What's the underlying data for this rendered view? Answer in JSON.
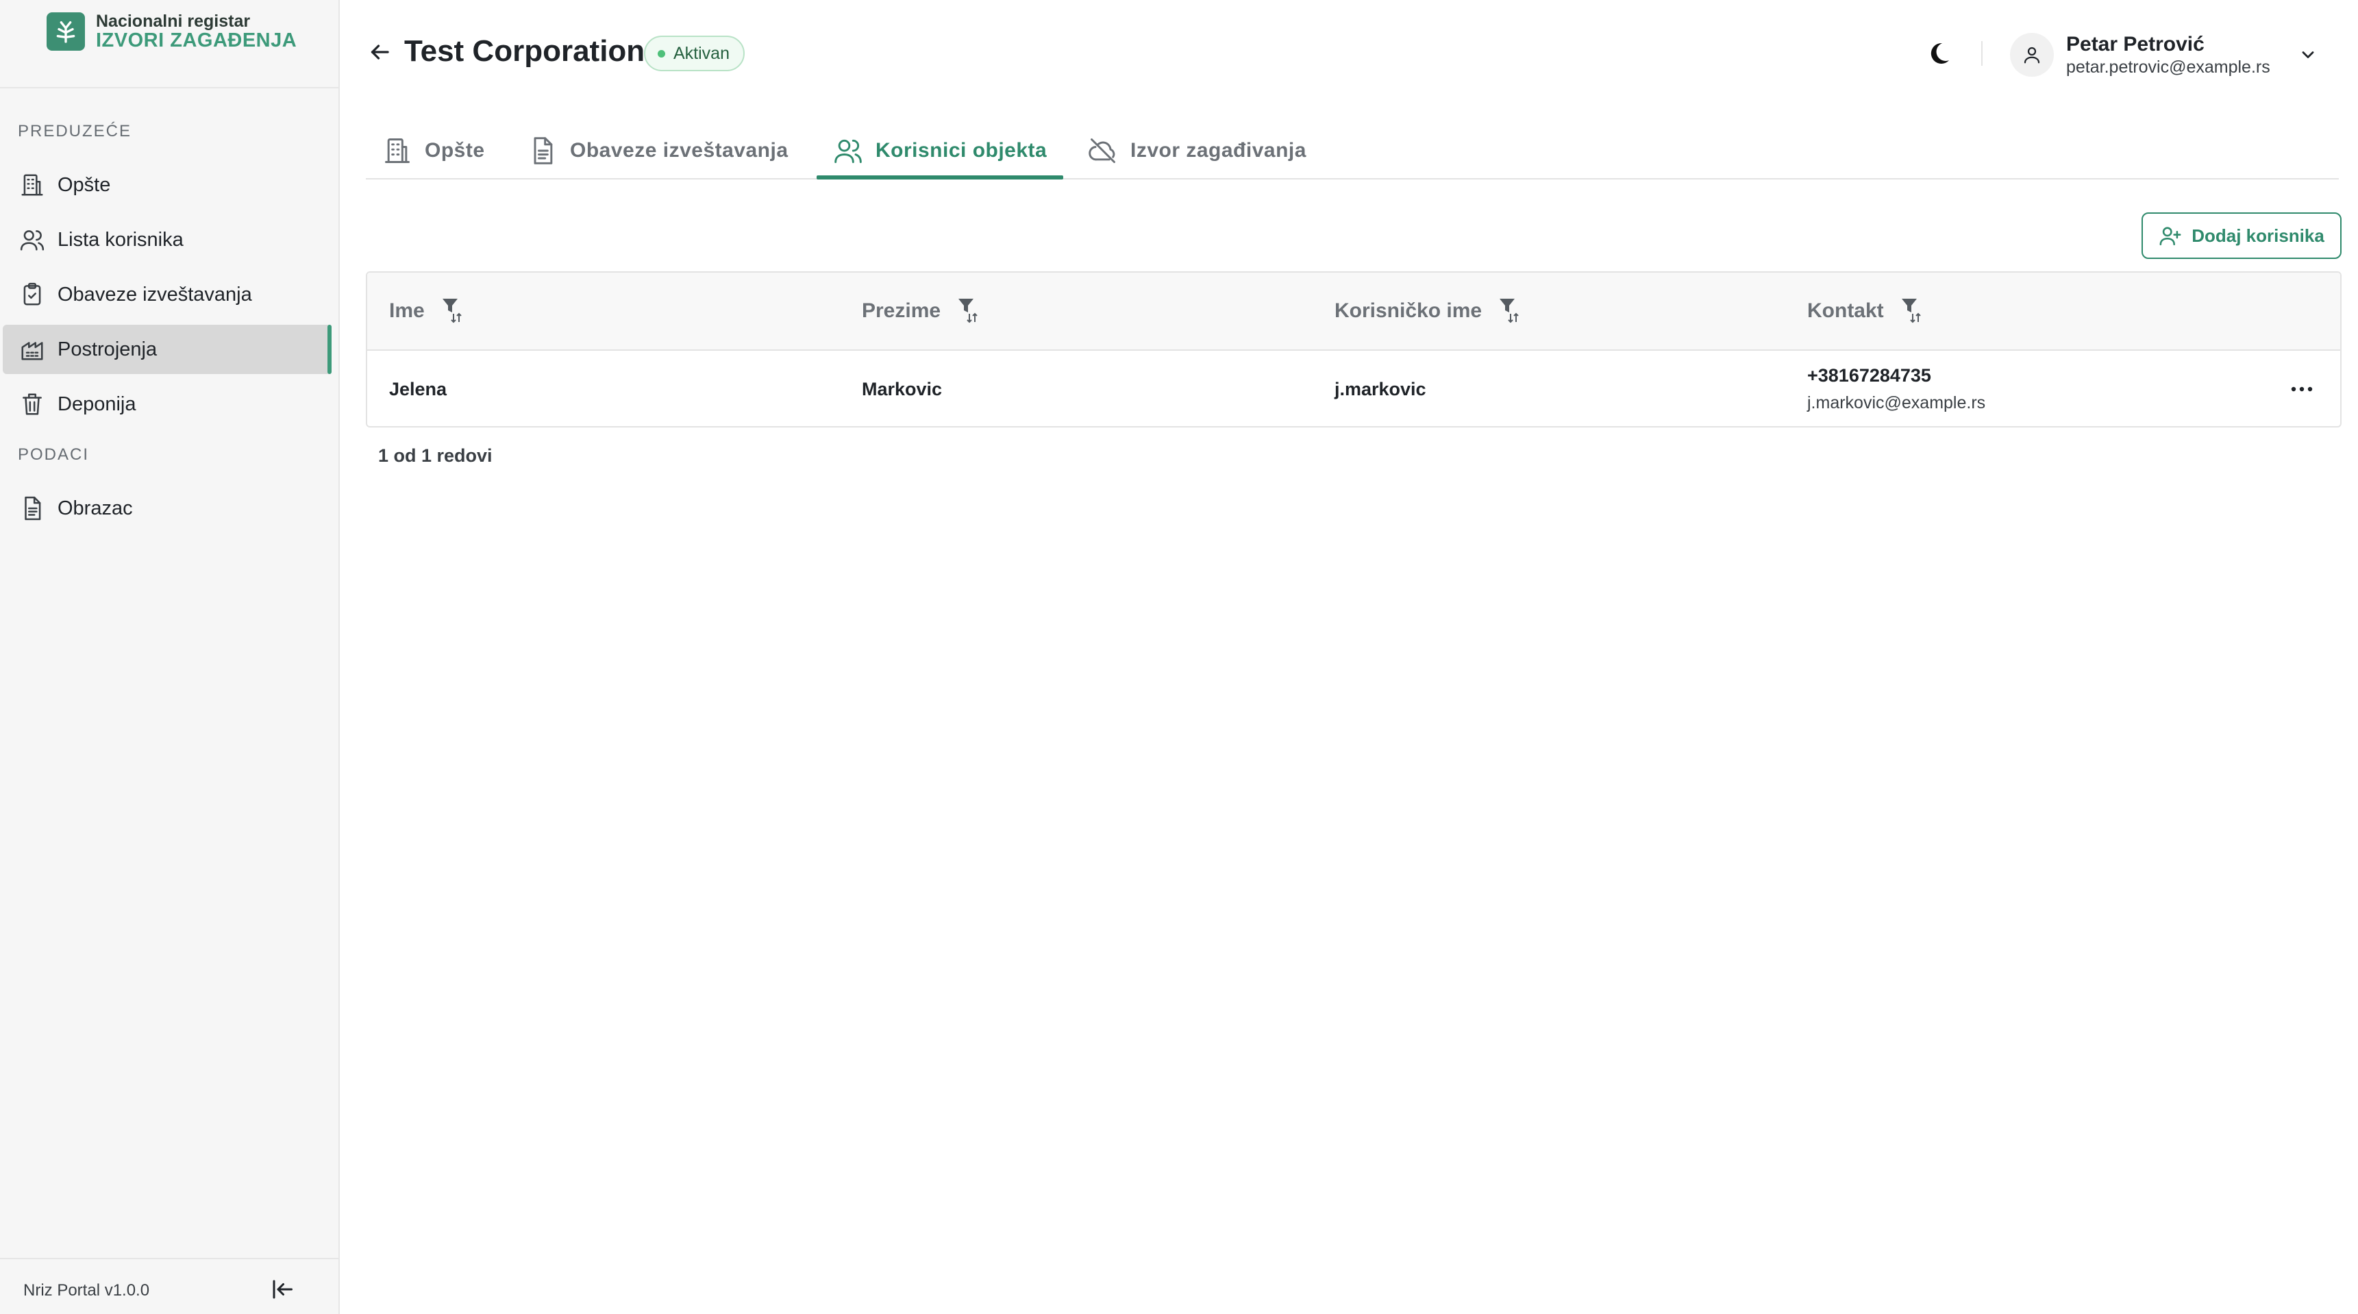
{
  "logo": {
    "line1": "Nacionalni registar",
    "line2": "IZVORI ZAGAĐENJA",
    "icon": "leaf-icon"
  },
  "sidebar": {
    "section_company": "PREDUZEĆE",
    "section_data": "PODACI",
    "items": [
      {
        "label": "Opšte",
        "icon": "building-icon",
        "active": false
      },
      {
        "label": "Lista korisnika",
        "icon": "users-icon",
        "active": false
      },
      {
        "label": "Obaveze izveštavanja",
        "icon": "clipboard-check-icon",
        "active": false
      },
      {
        "label": "Postrojenja",
        "icon": "factory-icon",
        "active": true
      },
      {
        "label": "Deponija",
        "icon": "trash-icon",
        "active": false
      },
      {
        "label": "Obrazac",
        "icon": "document-icon",
        "active": false
      }
    ],
    "version": "Nriz Portal v1.0.0"
  },
  "header": {
    "title": "Test Corporation",
    "status": "Aktivan",
    "status_color": "#4fc07a"
  },
  "user": {
    "name": "Petar Petrović",
    "email": "petar.petrovic@example.rs"
  },
  "tabs": [
    {
      "label": "Opšte",
      "icon": "building-icon",
      "active": false
    },
    {
      "label": "Obaveze izveštavanja",
      "icon": "document-icon",
      "active": false
    },
    {
      "label": "Korisnici objekta",
      "icon": "users-icon",
      "active": true
    },
    {
      "label": "Izvor zagađivanja",
      "icon": "cloud-off-icon",
      "active": false
    }
  ],
  "actions": {
    "add_user": "Dodaj korisnika"
  },
  "table": {
    "columns": [
      "Ime",
      "Prezime",
      "Korisničko ime",
      "Kontakt"
    ],
    "rows": [
      {
        "first_name": "Jelena",
        "last_name": "Markovic",
        "username": "j.markovic",
        "phone": "+38167284735",
        "email": "j.markovic@example.rs"
      }
    ],
    "row_count": "1 od 1 redovi"
  },
  "colors": {
    "accent": "#2f8a6c",
    "brand": "#3d9a7a",
    "active_nav_bg": "#d8d8d8"
  }
}
